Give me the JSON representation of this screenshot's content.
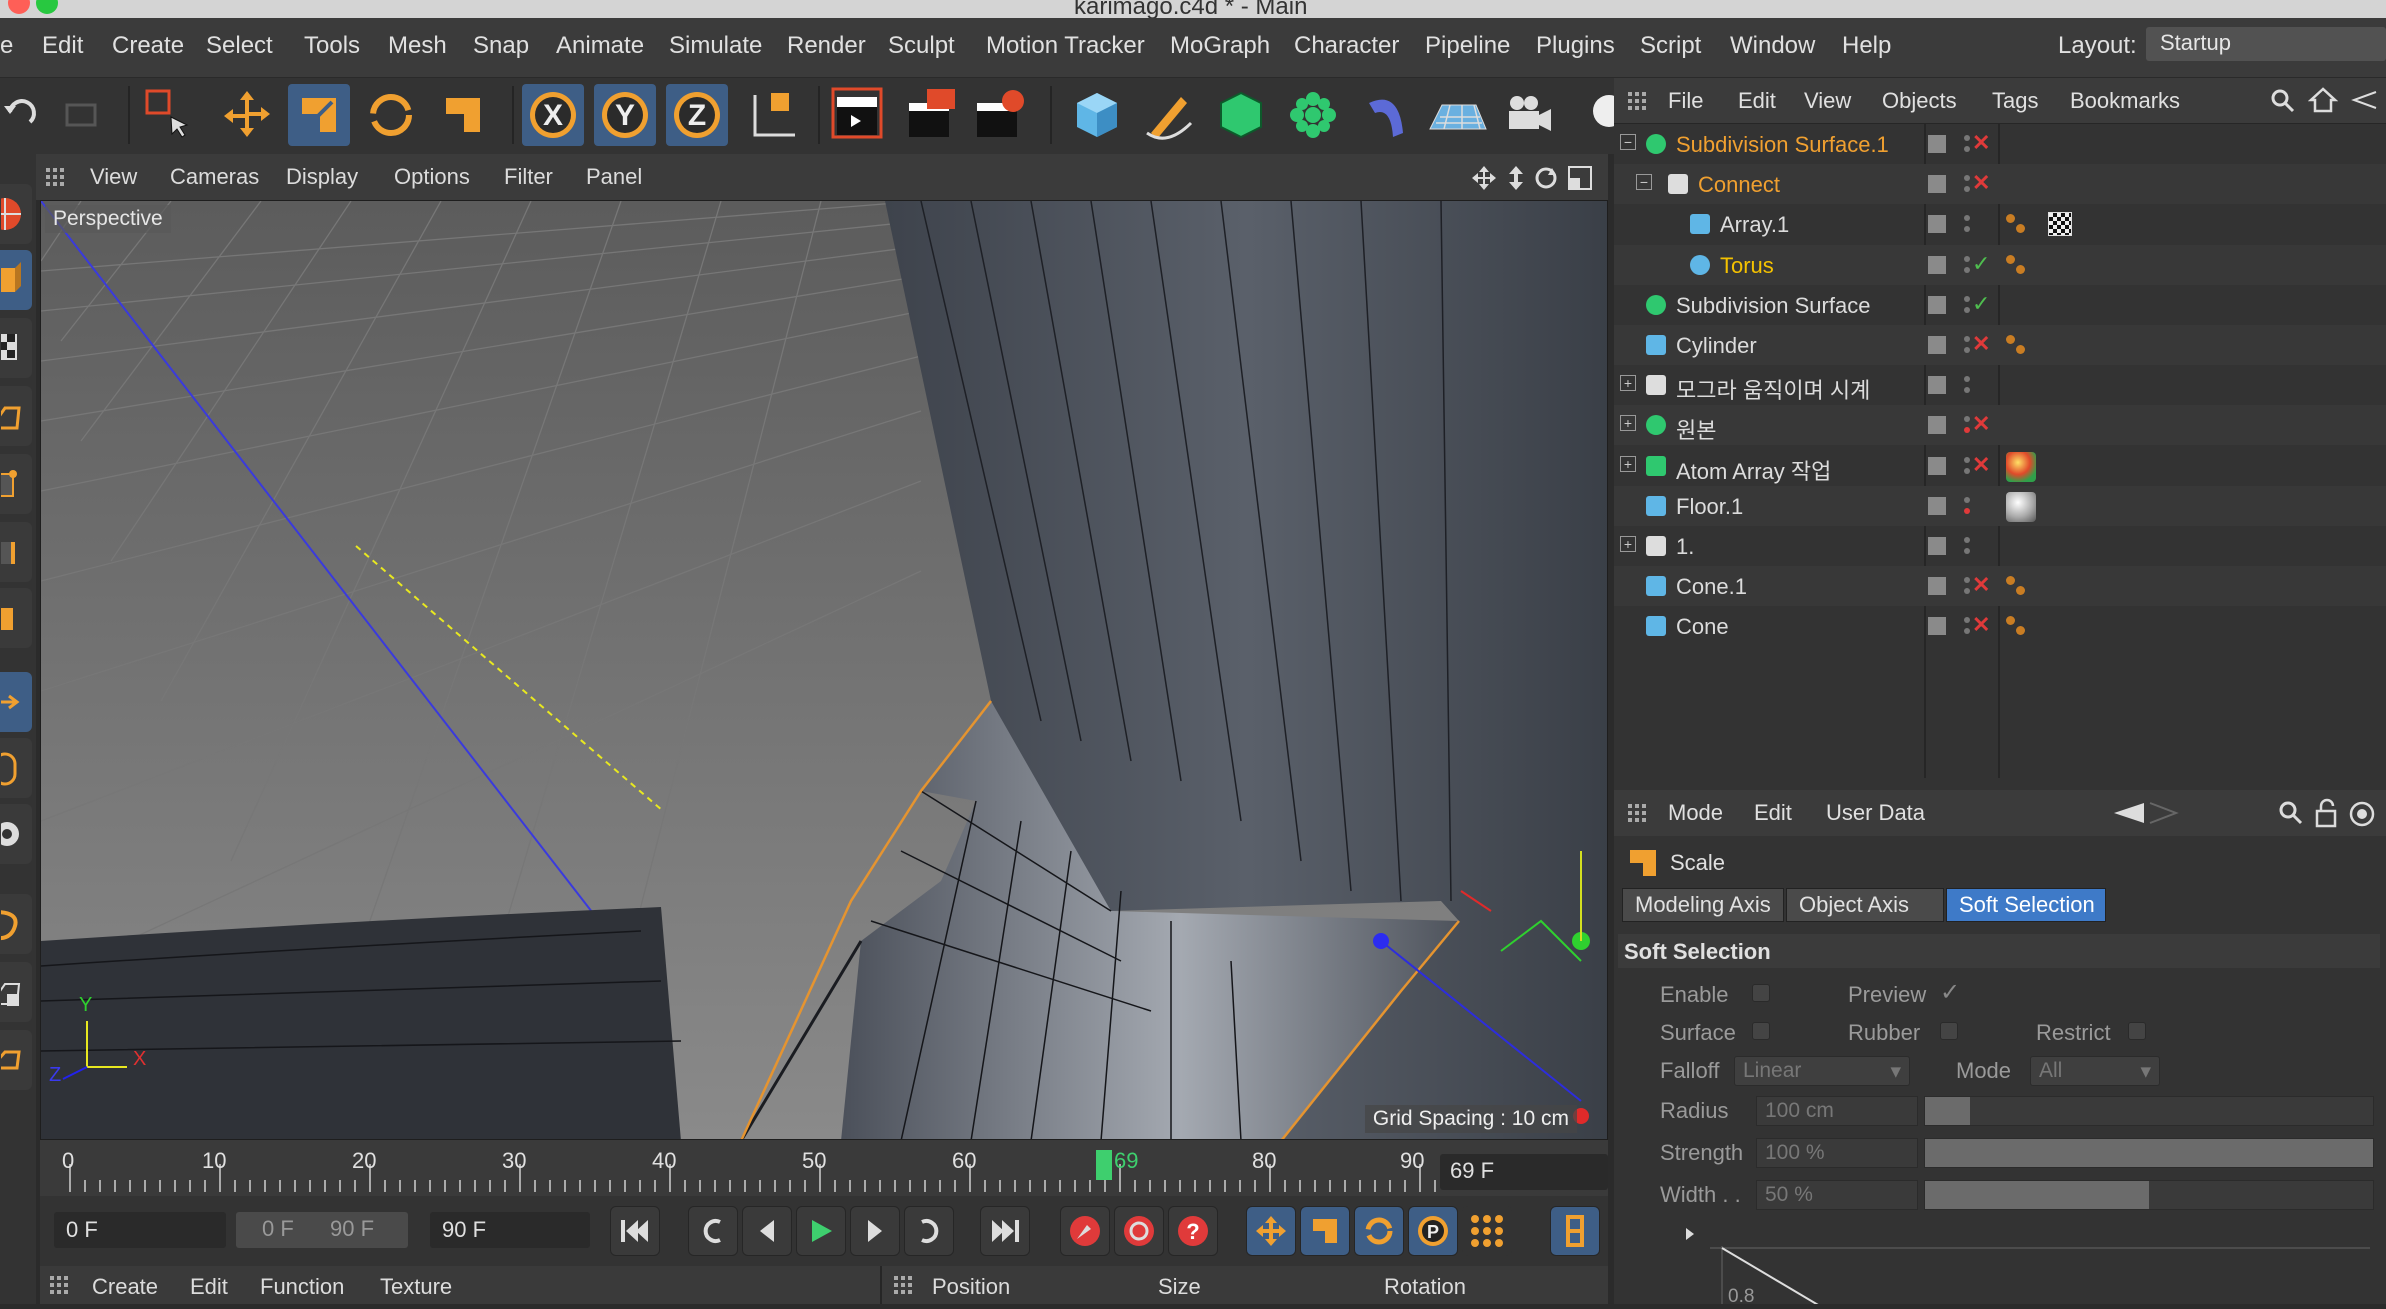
{
  "window": {
    "title": "karimago.c4d * - Main"
  },
  "menubar": {
    "items": [
      "e",
      "Edit",
      "Create",
      "Select",
      "Tools",
      "Mesh",
      "Snap",
      "Animate",
      "Simulate",
      "Render",
      "Sculpt",
      "Motion Tracker",
      "MoGraph",
      "Character",
      "Pipeline",
      "Plugins",
      "Script",
      "Window",
      "Help"
    ],
    "layout_label": "Layout:",
    "layout_value": "Startup"
  },
  "toolbar": {
    "axis_x": "X",
    "axis_y": "Y",
    "axis_z": "Z"
  },
  "viewport": {
    "menu": [
      "View",
      "Cameras",
      "Display",
      "Options",
      "Filter",
      "Panel"
    ],
    "label": "Perspective",
    "grid_spacing": "Grid Spacing : 10 cm",
    "axis_labels": {
      "y": "Y",
      "z": "Z",
      "x": "X"
    }
  },
  "timeline": {
    "ticks": [
      "0",
      "10",
      "20",
      "30",
      "40",
      "50",
      "60",
      "69",
      "80",
      "90"
    ],
    "current_frame": "69",
    "current_frame_field": "69 F"
  },
  "transport": {
    "start_field": "0 F",
    "range_start": "0 F",
    "range_end": "90 F",
    "end_field": "90 F"
  },
  "bottom_menu": {
    "left": [
      "Create",
      "Edit",
      "Function",
      "Texture"
    ],
    "right": [
      "Position",
      "Size",
      "Rotation"
    ]
  },
  "object_manager": {
    "menu": [
      "File",
      "Edit",
      "View",
      "Objects",
      "Tags",
      "Bookmarks"
    ],
    "objects": [
      {
        "name": "Subdivision Surface.1",
        "color": "#f0a030",
        "status": "x",
        "icon": "subdivision-icon",
        "tags": 0
      },
      {
        "name": "Connect",
        "color": "#f0a030",
        "status": "x",
        "icon": "connect-icon",
        "tags": 0
      },
      {
        "name": "Array.1",
        "color": "#dcdcdc",
        "status": "",
        "icon": "array-icon",
        "tags": 2
      },
      {
        "name": "Torus",
        "color": "#f5c200",
        "status": "check",
        "icon": "torus-icon",
        "tags": 1
      },
      {
        "name": "Subdivision Surface",
        "color": "#dcdcdc",
        "status": "check",
        "icon": "subdivision-icon",
        "tags": 0
      },
      {
        "name": "Cylinder",
        "color": "#dcdcdc",
        "status": "x",
        "icon": "cylinder-icon",
        "tags": 1
      },
      {
        "name": "모그라 움직이며 시계",
        "color": "#dcdcdc",
        "status": "",
        "icon": "null-icon",
        "tags": 0
      },
      {
        "name": "원본",
        "color": "#dcdcdc",
        "status": "x",
        "icon": "subdivision-icon",
        "tags": 0
      },
      {
        "name": "Atom Array 작업",
        "color": "#dcdcdc",
        "status": "x",
        "icon": "atom-array-icon",
        "tags": 3
      },
      {
        "name": "Floor.1",
        "color": "#dcdcdc",
        "status": "",
        "icon": "floor-icon",
        "tags": 4
      },
      {
        "name": "1.",
        "color": "#dcdcdc",
        "status": "",
        "icon": "null-icon",
        "tags": 0
      },
      {
        "name": "Cone.1",
        "color": "#dcdcdc",
        "status": "x",
        "icon": "cone-icon",
        "tags": 1
      },
      {
        "name": "Cone",
        "color": "#dcdcdc",
        "status": "x",
        "icon": "cone-icon",
        "tags": 1
      }
    ]
  },
  "attributes": {
    "menu": [
      "Mode",
      "Edit",
      "User Data"
    ],
    "tool_name": "Scale",
    "tabs": [
      "Modeling Axis",
      "Object Axis",
      "Soft Selection"
    ],
    "active_tab": "Soft Selection",
    "section_title": "Soft Selection",
    "enable_label": "Enable",
    "preview_label": "Preview",
    "surface_label": "Surface",
    "rubber_label": "Rubber",
    "restrict_label": "Restrict",
    "falloff_label": "Falloff",
    "falloff_value": "Linear",
    "mode_label": "Mode",
    "mode_value": "All",
    "radius_label": "Radius",
    "radius_value": "100 cm",
    "radius_fraction": 0.1,
    "strength_label": "Strength",
    "strength_value": "100 %",
    "strength_fraction": 1.0,
    "width_label": "Width . .",
    "width_value": "50 %",
    "width_fraction": 0.5,
    "curve_tick": "0.8"
  },
  "colors": {
    "accent_blue": "#3e7ac8",
    "highlight_orange": "#f0a030",
    "active_yellow": "#f5c200",
    "timeline_marker": "#3ecf6e"
  }
}
